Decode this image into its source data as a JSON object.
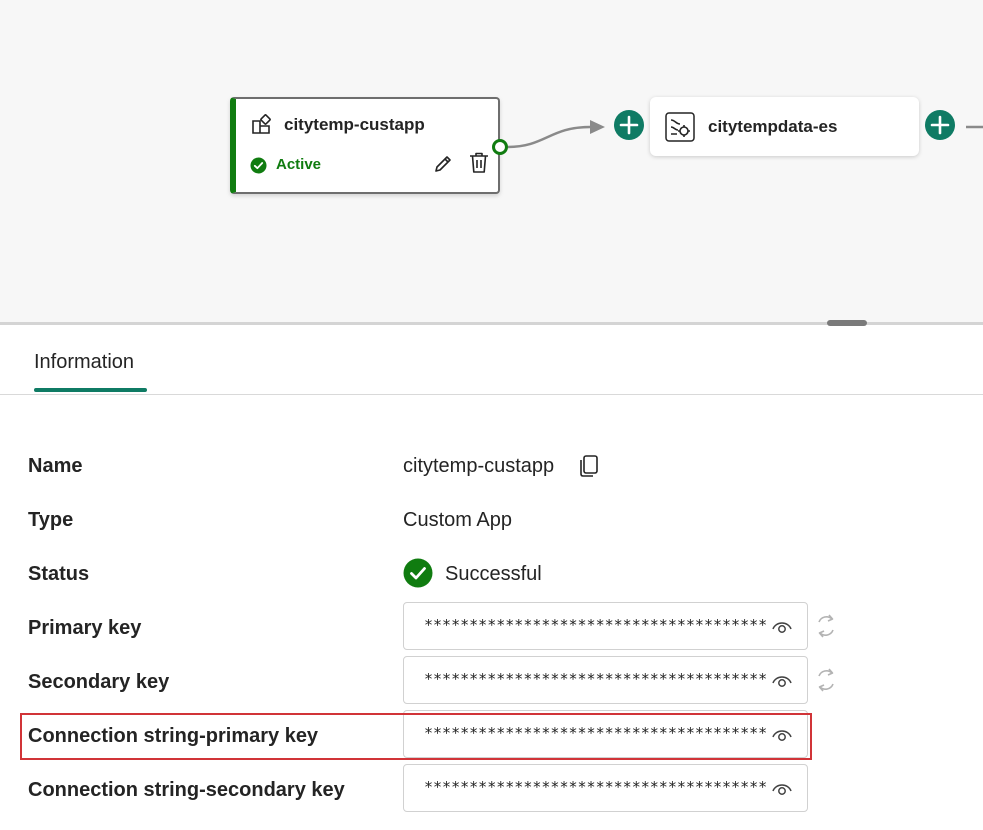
{
  "canvas": {
    "source_node": {
      "title": "citytemp-custapp",
      "status": "Active",
      "icon": "custom-app-icon"
    },
    "eventstream_node": {
      "title": "citytempdata-es",
      "icon": "eventstream-icon"
    },
    "add_icon": "plus-icon"
  },
  "panel": {
    "tabs": [
      {
        "label": "Information",
        "active": true
      }
    ],
    "fields": {
      "name": {
        "label": "Name",
        "value": "citytemp-custapp"
      },
      "type": {
        "label": "Type",
        "value": "Custom App"
      },
      "status": {
        "label": "Status",
        "value": "Successful"
      },
      "primary_key": {
        "label": "Primary key",
        "value": "**************************************"
      },
      "secondary_key": {
        "label": "Secondary key",
        "value": "**************************************"
      },
      "conn_primary": {
        "label": "Connection string-primary key",
        "value": "**************************************"
      },
      "conn_secondary": {
        "label": "Connection string-secondary key",
        "value": "**************************************"
      }
    }
  },
  "colors": {
    "accent": "#0f7b64",
    "success": "#107c10",
    "highlight": "#d13438"
  }
}
